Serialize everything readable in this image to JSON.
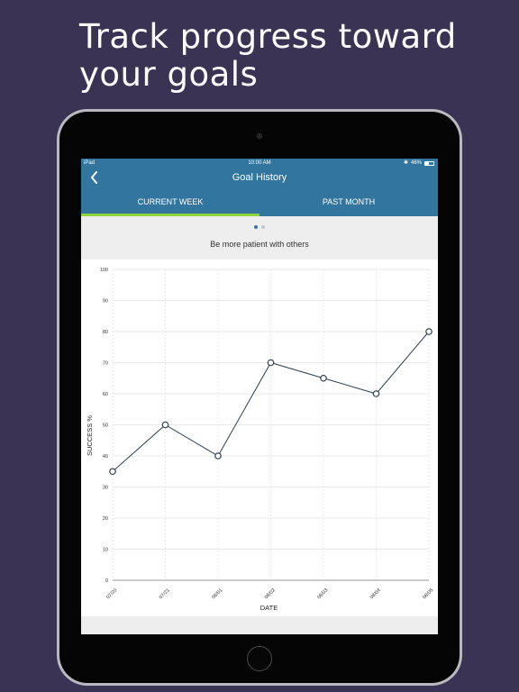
{
  "promo": {
    "headline": "Track progress toward your goals"
  },
  "status_bar": {
    "device": "iPad",
    "time": "10:00 AM",
    "bluetooth": "✱",
    "battery_text": "46%",
    "battery_level": 0.46
  },
  "nav": {
    "back_icon": "chevron-left-icon",
    "title": "Goal History"
  },
  "tabs": [
    {
      "label": "CURRENT WEEK",
      "selected": true
    },
    {
      "label": "PAST MONTH",
      "selected": false
    }
  ],
  "pager": {
    "pages": 2,
    "current": 0
  },
  "goal": {
    "title": "Be more patient with others"
  },
  "colors": {
    "page_background": "#3b3354",
    "header": "#3276a0",
    "tab_indicator": "#8fd33b",
    "line": "#2b3e50",
    "grid": "#e8e8e8",
    "pager_active": "#3276a0",
    "pager_inactive": "#b8c8d4"
  },
  "chart_data": {
    "type": "line",
    "categories": [
      "07/20",
      "07/21",
      "08/01",
      "08/02",
      "08/03",
      "08/04",
      "08/05"
    ],
    "values": [
      35,
      50,
      40,
      70,
      65,
      60,
      80
    ],
    "xlabel": "DATE",
    "ylabel": "SUCCESS %",
    "ylim": [
      0,
      100
    ],
    "yticks": [
      0,
      10,
      20,
      30,
      40,
      50,
      60,
      70,
      80,
      90,
      100
    ],
    "grid": true,
    "markers": "open-circle"
  }
}
